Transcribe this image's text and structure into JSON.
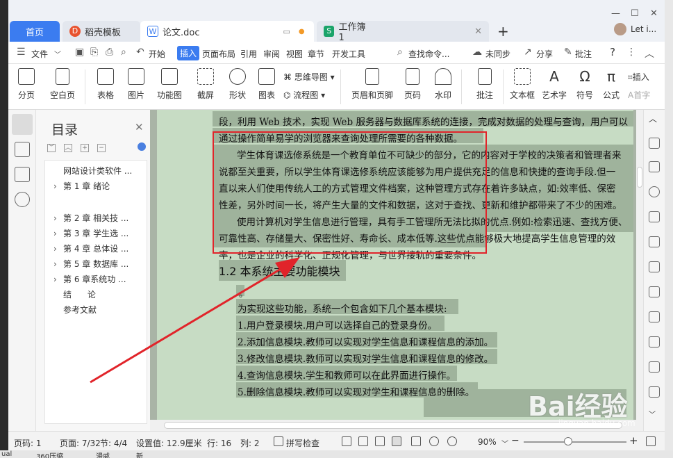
{
  "tabs": {
    "home": "首页",
    "daoke": "稻壳模板",
    "doc": "论文.doc",
    "xls": "工作簿1",
    "user": "Let i..."
  },
  "menu": {
    "file": "文件",
    "items": [
      "开始",
      "插入",
      "页面布局",
      "引用",
      "审阅",
      "视图",
      "章节",
      "开发工具"
    ],
    "search": "查找命令...",
    "sync": "未同步",
    "share": "分享",
    "comment": "批注",
    "help": "?"
  },
  "ribbon": {
    "page_break": "分页",
    "blank_page": "空白页",
    "table": "表格",
    "picture": "图片",
    "func_chart": "功能图",
    "screenshot": "截屏",
    "shape": "形状",
    "chart": "图表",
    "mindmap": "思维导图",
    "flowchart": "流程图",
    "header_footer": "页眉和页脚",
    "page_num": "页码",
    "watermark": "水印",
    "annotation": "批注",
    "textbox": "文本框",
    "art_text": "艺术字",
    "symbol": "符号",
    "formula": "公式",
    "insert_num": "插入",
    "first_drop": "首字"
  },
  "toc": {
    "title": "目录",
    "items": [
      {
        "label": "网站设计类软件 ...",
        "arrow": false
      },
      {
        "label": "第 1 章 绪论",
        "arrow": true
      },
      {
        "label": "第 2 章 相关技 ...",
        "arrow": true
      },
      {
        "label": "第 3 章 学生选 ...",
        "arrow": true
      },
      {
        "label": "第 4 章 总体设 ...",
        "arrow": true
      },
      {
        "label": "第 5 章 数据库 ...",
        "arrow": true
      },
      {
        "label": "第 6 章系统功 ...",
        "arrow": true
      },
      {
        "label": "结      论",
        "arrow": false
      },
      {
        "label": "参考文献",
        "arrow": false
      }
    ]
  },
  "doc": {
    "lines": [
      "段，利用 Web 技术，实现 Web 服务器与数据库系统的连接，完成对数据的处理与查询，用户可以",
      "通过操作简单易学的浏览器来查询处理所需要的各种数据。",
      "学生体育课选修系统是一个教育单位不可缺少的部分，它的内容对于学校的决策者和管理者来",
      "说都至关重要，所以学生体育课选修系统应该能够为用户提供充足的信息和快捷的查询手段.但一",
      "直以来人们使用传统人工的方式管理文件档案，这种管理方式存在着许多缺点，如:效率低、保密",
      "性差，另外时间一长，将产生大量的文件和数据，这对于查找、更新和维护都带来了不少的困难。",
      "使用计算机对学生信息进行管理，具有手工管理所无法比拟的优点.例如:检索迅速、查找方便、",
      "可靠性高、存储量大、保密性好、寿命长、成本低等.这些优点能够极大地提高学生信息管理的效",
      "率，也是企业的科学化、正规化管理，与世界接轨的重要条件。"
    ],
    "heading": "1.2  本系统主要功能模块",
    "dot": "。",
    "list_intro": "为实现这些功能，系统一个包含如下几个基本模块:",
    "list": [
      "1.用户登录模块.用户可以选择自己的登录身份。",
      "2.添加信息模块.教师可以实现对学生信息和课程信息的添加。",
      "3.修改信息模块.教师可以实现对学生信息和课程信息的修改。",
      "4.查询信息模块.学生和教师可以在此界面进行操作。",
      "5.删除信息模块.教师可以实现对学生和课程信息的删除。"
    ]
  },
  "status": {
    "page_num": "页码: 1",
    "pages": "页面: 7/32",
    "section": "节: 4/4",
    "setting": "设置值: 12.9厘米",
    "row": "行: 16",
    "col": "列: 2",
    "spell": "拼写检查",
    "zoom": "90%"
  },
  "watermark": {
    "main": "Bai经验",
    "sub": "jingyan.baidu.com"
  },
  "taskbar": {
    "a": "ual",
    "b": "360压缩",
    "c": "漫威",
    "d": "新"
  },
  "colors": {
    "accent": "#3b7cf0",
    "page": "#c7dcc4",
    "highlight": "#9fb39c",
    "annotation": "#e1242a"
  }
}
